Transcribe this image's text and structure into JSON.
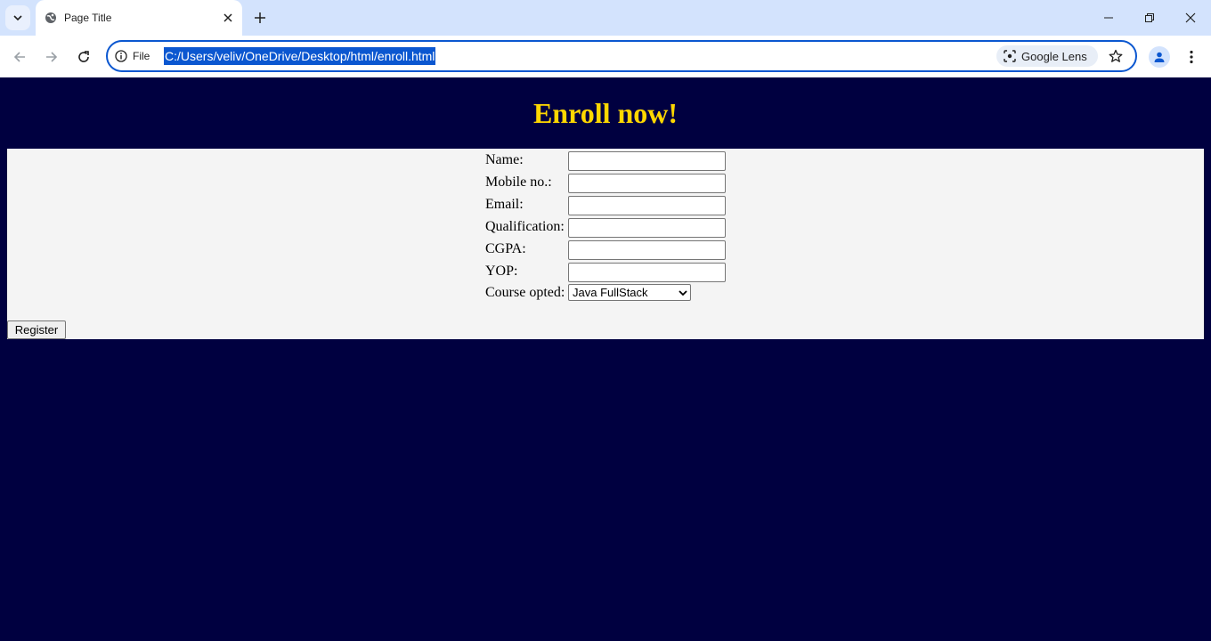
{
  "browser": {
    "tab_title": "Page Title",
    "site_info_label": "File",
    "url": "C:/Users/veliv/OneDrive/Desktop/html/enroll.html",
    "lens_label": "Google Lens",
    "accent_color": "#0b57d0"
  },
  "page": {
    "heading": "Enroll now!",
    "heading_color": "#ffd700",
    "background_color": "#000040",
    "form": {
      "fields": [
        {
          "label": "Name:",
          "value": ""
        },
        {
          "label": "Mobile no.:",
          "value": ""
        },
        {
          "label": "Email:",
          "value": ""
        },
        {
          "label": "Qualification:",
          "value": ""
        },
        {
          "label": "CGPA:",
          "value": ""
        },
        {
          "label": "YOP:",
          "value": ""
        }
      ],
      "course_label": "Course opted:",
      "course_selected": "Java FullStack",
      "submit_label": "Register"
    }
  }
}
